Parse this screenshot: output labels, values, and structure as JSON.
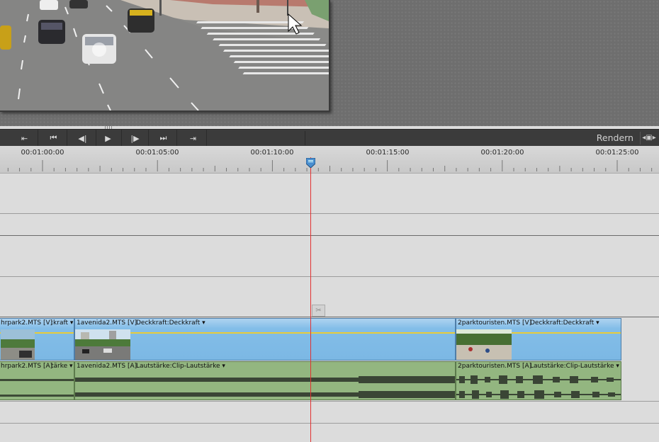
{
  "transport": {
    "buttons": [
      {
        "name": "go-to-in-point",
        "glyph": "⇤"
      },
      {
        "name": "go-to-previous-edit",
        "glyph": "⏮"
      },
      {
        "name": "step-back",
        "glyph": "◀|"
      },
      {
        "name": "play",
        "glyph": "▶"
      },
      {
        "name": "step-forward",
        "glyph": "|▶"
      },
      {
        "name": "go-to-next-edit",
        "glyph": "⏭"
      },
      {
        "name": "go-to-out-point",
        "glyph": "⇥"
      }
    ],
    "render_label": "Rendern"
  },
  "ruler": {
    "timecodes": [
      "00:01:00:00",
      "00:01:05:00",
      "00:01:10:00",
      "00:01:15:00",
      "00:01:20:00",
      "00:01:25:00"
    ]
  },
  "clips": {
    "video": [
      {
        "label": "hrpark2.MTS [V]",
        "effect": ":kraft"
      },
      {
        "label": "1avenida2.MTS [V]",
        "effect": "Deckkraft:Deckkraft"
      },
      {
        "label": "2parktouristen.MTS [V]",
        "effect": "Deckkraft:Deckkraft"
      }
    ],
    "audio": [
      {
        "label": "hrpark2.MTS [A]",
        "effect": "tärke"
      },
      {
        "label": "1avenida2.MTS [A]",
        "effect": "Lautstärke:Clip-Lautstärke"
      },
      {
        "label": "2parktouristen.MTS [A]",
        "effect": "Lautstärke:Clip-Lautstärke"
      }
    ]
  },
  "colors": {
    "playhead": "#e23030",
    "video_clip": "#82bde8",
    "audio_clip": "#93b680",
    "keyframe_line": "#e8cc3a"
  },
  "icons": {
    "scissors": "scissors-icon",
    "playhead": "playhead-marker-icon"
  }
}
